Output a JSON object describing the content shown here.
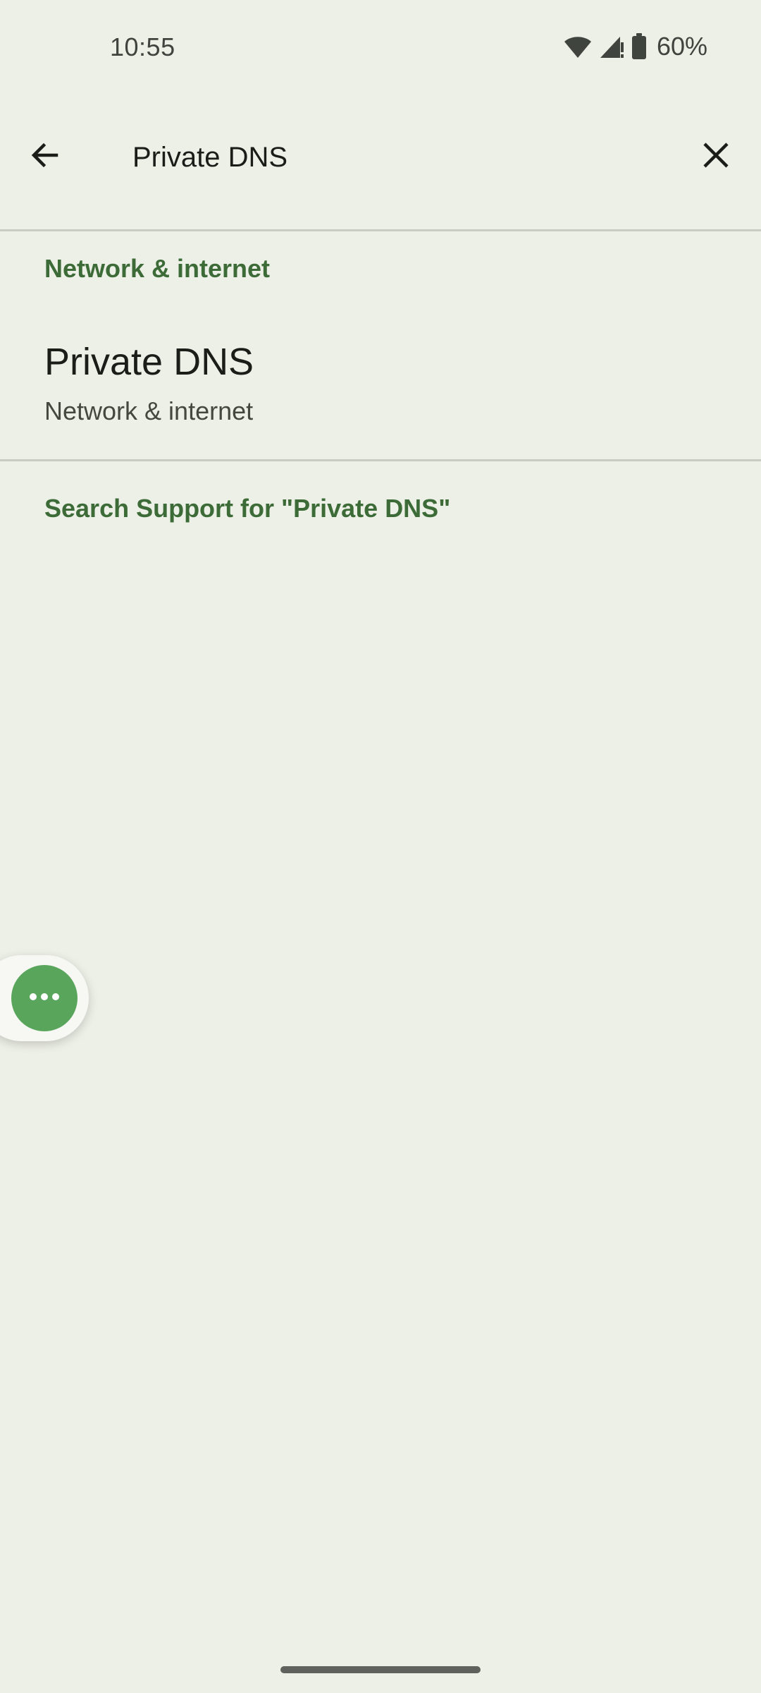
{
  "status_bar": {
    "time": "10:55",
    "battery_percent": "60%",
    "icons": [
      "wifi-icon",
      "cell-signal-icon",
      "battery-icon"
    ]
  },
  "search": {
    "query": "Private DNS",
    "back_icon": "arrow-back-icon",
    "clear_icon": "close-icon"
  },
  "results": {
    "category": "Network & internet",
    "items": [
      {
        "title": "Private DNS",
        "subtitle": "Network & internet"
      }
    ],
    "support_link": "Search Support for \"Private DNS\""
  },
  "floating_bubble": {
    "icon": "more-horiz-icon",
    "color": "#5aa55c"
  },
  "colors": {
    "background": "#edf0e7",
    "accent": "#3c6b38"
  }
}
